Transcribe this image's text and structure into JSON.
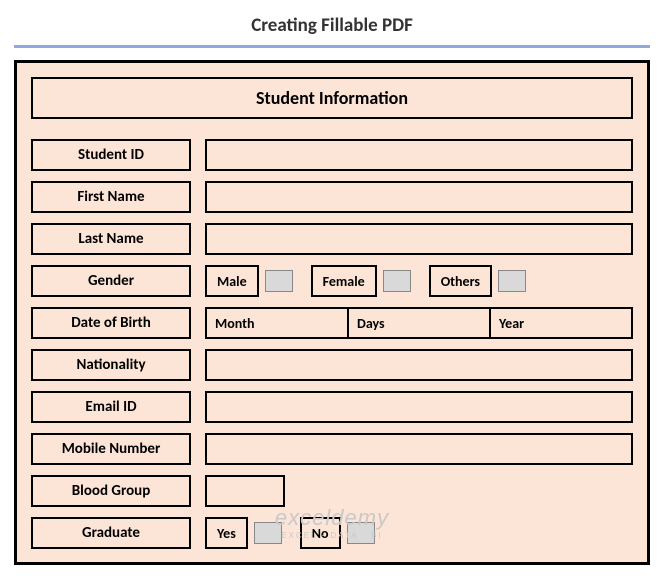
{
  "page_title": "Creating Fillable PDF",
  "section_title": "Student Information",
  "labels": {
    "student_id": "Student ID",
    "first_name": "First Name",
    "last_name": "Last Name",
    "gender": "Gender",
    "dob": "Date of Birth",
    "nationality": "Nationality",
    "email": "Email ID",
    "mobile": "Mobile Number",
    "blood_group": "Blood Group",
    "graduate": "Graduate"
  },
  "gender_options": {
    "male": "Male",
    "female": "Female",
    "others": "Others"
  },
  "dob_parts": {
    "month": "Month",
    "days": "Days",
    "year": "Year"
  },
  "graduate_options": {
    "yes": "Yes",
    "no": "No"
  },
  "watermark": {
    "main": "exceldemy",
    "sub": "EXCEL · DATA · BI"
  }
}
